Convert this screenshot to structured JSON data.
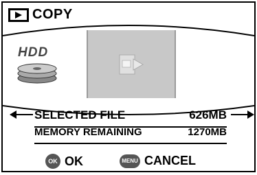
{
  "header": {
    "title": "COPY",
    "icon": "playback-icon"
  },
  "carousel": {
    "hdd_label": "HDD"
  },
  "info": {
    "selected_label": "SELECTED FILE",
    "selected_value": "626MB",
    "memory_label": "MEMORY REMAINING",
    "memory_value": "1270MB"
  },
  "buttons": {
    "ok_badge": "OK",
    "ok_label": "OK",
    "menu_badge": "MENU",
    "cancel_label": "CANCEL"
  },
  "colors": {
    "panel_gray": "#c8c8c8",
    "badge_gray": "#555555",
    "text": "#000000"
  }
}
